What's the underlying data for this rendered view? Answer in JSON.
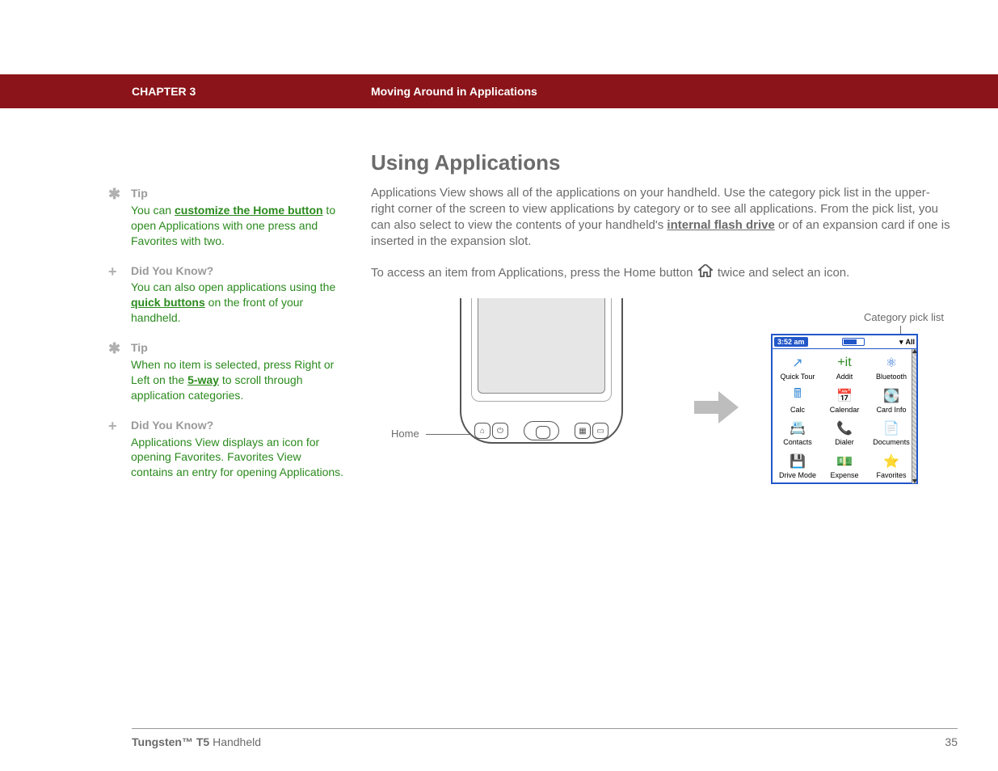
{
  "header": {
    "chapter": "CHAPTER 3",
    "title": "Moving Around in Applications"
  },
  "sidebar": [
    {
      "icon": "asterisk",
      "heading": "Tip",
      "segments": [
        {
          "t": "You can "
        },
        {
          "t": "customize the Home button",
          "link": true
        },
        {
          "t": " to open Applications with one press and Favorites with two."
        }
      ]
    },
    {
      "icon": "plus",
      "heading": "Did You Know?",
      "segments": [
        {
          "t": "You can also open applications using the "
        },
        {
          "t": "quick buttons",
          "link": true
        },
        {
          "t": " on the front of your handheld."
        }
      ]
    },
    {
      "icon": "asterisk",
      "heading": "Tip",
      "segments": [
        {
          "t": "When no item is selected, press Right or Left on the "
        },
        {
          "t": "5-way",
          "link": true
        },
        {
          "t": " to scroll through application categories."
        }
      ]
    },
    {
      "icon": "plus",
      "heading": "Did You Know?",
      "segments": [
        {
          "t": "Applications View displays an icon for opening Favorites. Favorites View contains an entry for opening Applications."
        }
      ]
    }
  ],
  "main": {
    "heading": "Using Applications",
    "p1_parts": [
      {
        "t": "Applications View shows all of the applications on your handheld. Use the category pick list in the upper-right corner of the screen to view applications by category or to see all applications. From the pick list, you can also select to view the contents of your handheld's "
      },
      {
        "t": "internal flash drive",
        "link": true
      },
      {
        "t": " or of an expansion card if one is inserted in the expansion slot."
      }
    ],
    "p2_before": "To access an item from Applications, press the Home button ",
    "p2_after": " twice and select an icon."
  },
  "figure": {
    "home_label": "Home",
    "category_label": "Category pick list",
    "palm": {
      "time": "3:52 am",
      "category": "All",
      "apps": [
        {
          "label": "Quick Tour",
          "icon": "↗",
          "color": "#3a8bd8"
        },
        {
          "label": "Addit",
          "icon": "+it",
          "color": "#2b8a1e"
        },
        {
          "label": "Bluetooth",
          "icon": "⚛",
          "color": "#2f6fd0"
        },
        {
          "label": "Calc",
          "icon": "🖩",
          "color": "#3a8bd8"
        },
        {
          "label": "Calendar",
          "icon": "📅",
          "color": "#3a8bd8"
        },
        {
          "label": "Card Info",
          "icon": "💽",
          "color": "#d04a2f"
        },
        {
          "label": "Contacts",
          "icon": "📇",
          "color": "#3a8bd8"
        },
        {
          "label": "Dialer",
          "icon": "📞",
          "color": "#6a6a6a"
        },
        {
          "label": "Documents",
          "icon": "📄",
          "color": "#3a8bd8"
        },
        {
          "label": "Drive Mode",
          "icon": "💾",
          "color": "#3a8bd8"
        },
        {
          "label": "Expense",
          "icon": "💵",
          "color": "#2b8a1e"
        },
        {
          "label": "Favorites",
          "icon": "⭐",
          "color": "#e6b400"
        }
      ]
    }
  },
  "footer": {
    "product_bold": "Tungsten™ T5",
    "product_rest": " Handheld",
    "page": "35"
  }
}
